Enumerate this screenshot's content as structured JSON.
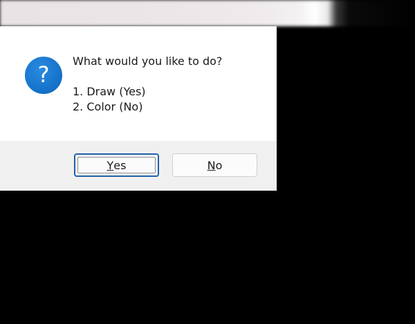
{
  "dialog": {
    "icon": "question-icon",
    "icon_glyph": "?",
    "message": {
      "prompt": "What would you like to do?",
      "options": [
        "1. Draw (Yes)",
        "2. Color (No)"
      ]
    },
    "buttons": {
      "yes": {
        "accel": "Y",
        "rest": "es"
      },
      "no": {
        "accel": "N",
        "rest": "o"
      }
    },
    "colors": {
      "icon_blue": "#1470c8",
      "focus_border": "#1f5fa8"
    }
  }
}
